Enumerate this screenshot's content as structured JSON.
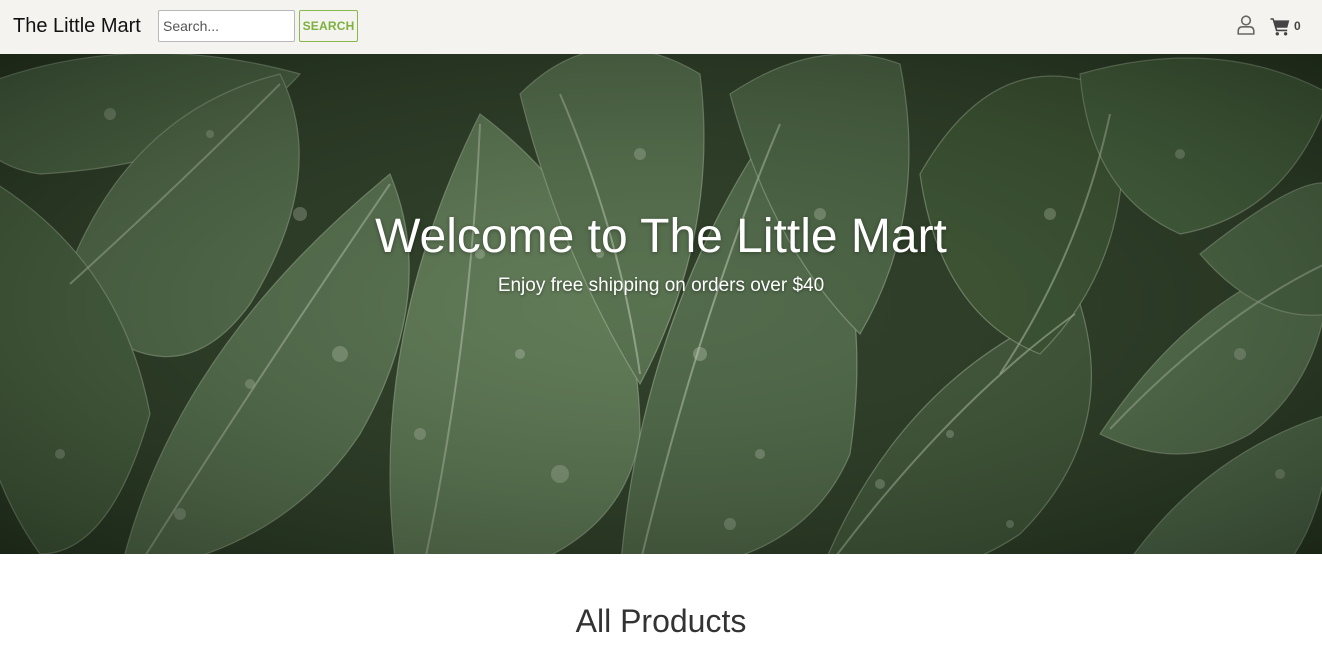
{
  "header": {
    "brand": "The Little Mart",
    "search": {
      "placeholder": "Search...",
      "value": "",
      "button_label": "SEARCH"
    },
    "user_icon": "user-icon",
    "cart_icon": "shopping-cart-icon",
    "cart_count": "0"
  },
  "hero": {
    "title": "Welcome to The Little Mart",
    "subtitle": "Enjoy free shipping on orders over $40",
    "background": "dark-green-leaves-with-water-droplets"
  },
  "main": {
    "section_title": "All Products"
  },
  "colors": {
    "header_bg": "#f5f3ef",
    "accent_green": "#7bb13c",
    "leaf_green": "#4e6a44",
    "text_dark": "#333333"
  }
}
